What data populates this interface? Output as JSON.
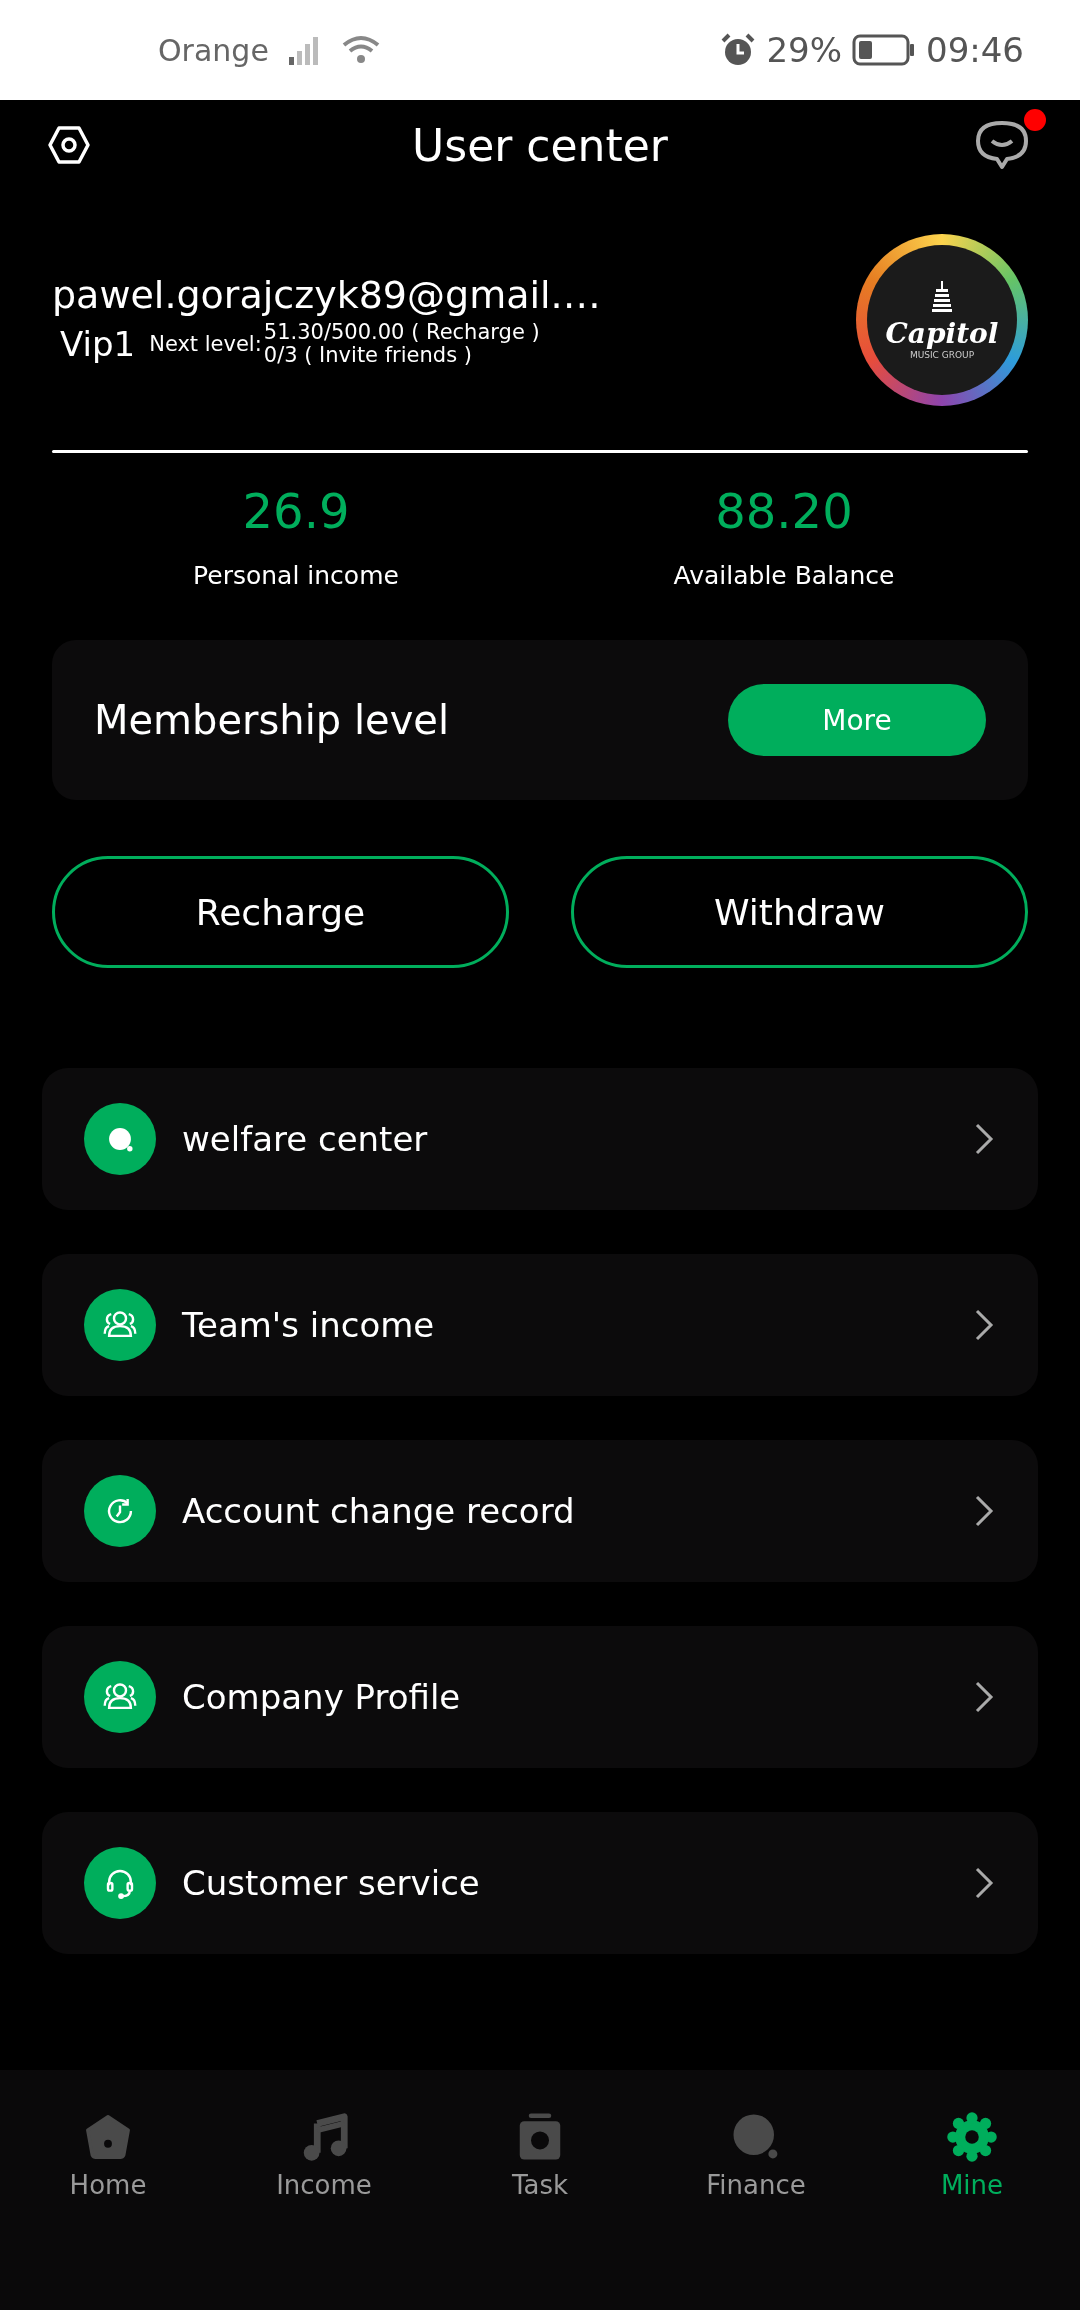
{
  "status_bar": {
    "carrier": "Orange",
    "battery": "29%",
    "time": "09:46"
  },
  "header": {
    "title": "User center",
    "has_notification": true
  },
  "profile": {
    "email": "pawel.gorajczyk89@gmail.…",
    "vip": "Vip1",
    "next_level_label": "Next level:",
    "progress_lines": [
      "51.30/500.00 ( Recharge )",
      "0/3 ( Invite friends )"
    ],
    "avatar": {
      "name": "Capitol",
      "subtitle": "MUSIC GROUP"
    }
  },
  "stats": [
    {
      "value": "26.9",
      "label": "Personal income"
    },
    {
      "value": "88.20",
      "label": "Available Balance"
    }
  ],
  "membership": {
    "title": "Membership level",
    "button": "More"
  },
  "actions": [
    "Recharge",
    "Withdraw"
  ],
  "menu": [
    {
      "label": "welfare center",
      "kind": "dot"
    },
    {
      "label": "Team's income",
      "kind": "people"
    },
    {
      "label": "Account change record",
      "kind": "clock"
    },
    {
      "label": "Company Profile",
      "kind": "people"
    },
    {
      "label": "Customer service",
      "kind": "headset"
    }
  ],
  "nav": [
    {
      "label": "Home",
      "kind": "home",
      "selected": false
    },
    {
      "label": "Income",
      "kind": "music",
      "selected": false
    },
    {
      "label": "Task",
      "kind": "task",
      "selected": false
    },
    {
      "label": "Finance",
      "kind": "dot",
      "selected": false
    },
    {
      "label": "Mine",
      "kind": "gear",
      "selected": true
    }
  ]
}
